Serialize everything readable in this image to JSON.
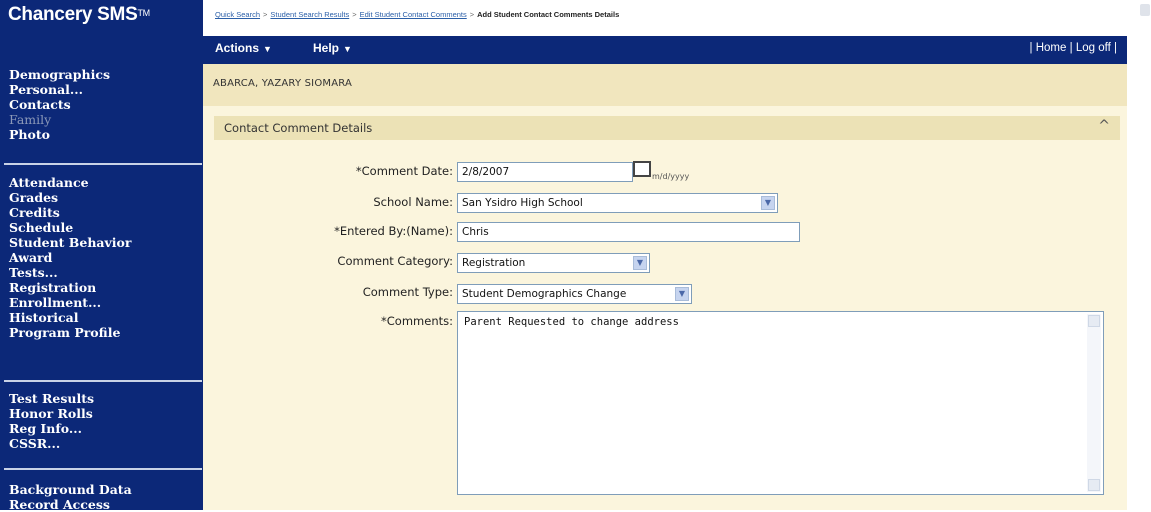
{
  "app": {
    "logo": "Chancery SMS",
    "logo_tm": "TM"
  },
  "breadcrumb": {
    "items": [
      "Quick Search",
      "Student Search Results",
      "Edit Student Contact Comments"
    ],
    "current": "Add Student Contact Comments Details",
    "separator": ">"
  },
  "menubar": {
    "actions": "Actions",
    "help": "Help",
    "home": "Home",
    "logoff": "Log off",
    "bar_sep": "|"
  },
  "sidebar": {
    "group1": [
      "Demographics",
      "Personal...",
      "Contacts",
      "Family",
      "Photo"
    ],
    "group2": [
      "Attendance",
      "Grades",
      "Credits",
      "Schedule",
      "Student Behavior",
      "Award",
      "Tests...",
      "Registration",
      "Enrollment...",
      "Historical",
      "Program Profile"
    ],
    "group3": [
      "Test Results",
      "Honor Rolls",
      "Reg Info...",
      "CSSR..."
    ],
    "group4": [
      "Background Data",
      "Record Access"
    ]
  },
  "student": {
    "name": "ABARCA, YAZARY SIOMARA"
  },
  "panel": {
    "title": "Contact Comment Details",
    "collapse_glyph": "^"
  },
  "form": {
    "comment_date": {
      "label": "*Comment Date:",
      "value": "2/8/2007",
      "format_hint": "m/d/yyyy"
    },
    "school_name": {
      "label": "School Name:",
      "value": "San Ysidro High School"
    },
    "entered_by": {
      "label": "*Entered By:(Name):",
      "value": "Chris"
    },
    "comment_category": {
      "label": "Comment Category:",
      "value": "Registration"
    },
    "comment_type": {
      "label": "Comment Type:",
      "value": "Student Demographics Change"
    },
    "comments": {
      "label": "*Comments:",
      "value": "Parent Requested to change address"
    }
  },
  "colors": {
    "nav_bg": "#0c2878",
    "student_strip": "#f1e6be",
    "content_bg": "#fbf5dd",
    "panel_head": "#ece2b6"
  }
}
